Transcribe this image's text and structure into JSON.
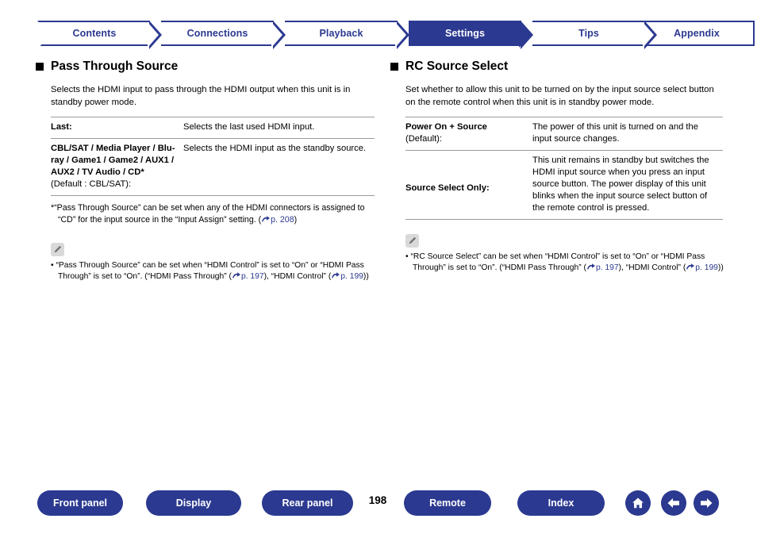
{
  "tabs": [
    {
      "label": "Contents",
      "active": false
    },
    {
      "label": "Connections",
      "active": false
    },
    {
      "label": "Playback",
      "active": false
    },
    {
      "label": "Settings",
      "active": true
    },
    {
      "label": "Tips",
      "active": false
    },
    {
      "label": "Appendix",
      "active": false
    }
  ],
  "left": {
    "heading": "Pass Through Source",
    "intro": "Selects the HDMI input to pass through the HDMI output when this unit is in standby power mode.",
    "rows": [
      {
        "key": "Last:",
        "key_sub": "",
        "value": "Selects the last used HDMI input."
      },
      {
        "key": "CBL/SAT / Media Player / Blu-ray / Game1 / Game2 / AUX1 / AUX2 / TV Audio / CD*",
        "key_sub": "(Default : CBL/SAT):",
        "value": "Selects the HDMI input as the standby source."
      }
    ],
    "footnote": "*“Pass Through Source” can be set when any of the HDMI connectors is assigned to “CD” for the input source in the “Input Assign” setting. (",
    "footnote_link": "p. 208",
    "footnote_end": ")",
    "note": "“Pass Through Source” can be set when “HDMI Control” is set to “On” or “HDMI Pass Through” is set to “On”. (“HDMI Pass Through” (",
    "note_link1": "p. 197",
    "note_mid": "), “HDMI Control” (",
    "note_link2": "p. 199",
    "note_end": "))"
  },
  "right": {
    "heading": "RC Source Select",
    "intro": "Set whether to allow this unit to be turned on by the input source select button on the remote control when this unit is in standby power mode.",
    "rows": [
      {
        "key": "Power On + Source",
        "key_sub": "(Default):",
        "value": "The power of this unit is turned on and the input source changes."
      },
      {
        "key": "Source Select Only:",
        "key_sub": "",
        "value": "This unit remains in standby but switches the HDMI input source when you press an input source button. The power display of this unit blinks when the input source select button of the remote control is pressed."
      }
    ],
    "note": "“RC Source Select” can be set when “HDMI Control” is set to “On” or “HDMI Pass Through” is set to “On”. (“HDMI Pass Through” (",
    "note_link1": "p. 197",
    "note_mid": "), “HDMI Control” (",
    "note_link2": "p. 199",
    "note_end": "))"
  },
  "footer": {
    "buttons": [
      {
        "label": "Front panel"
      },
      {
        "label": "Display"
      },
      {
        "label": "Rear panel"
      },
      {
        "label": "Remote"
      },
      {
        "label": "Index"
      }
    ],
    "page": "198"
  },
  "colors": {
    "brand": "#2b3990",
    "rule": "#9a9a9a"
  }
}
